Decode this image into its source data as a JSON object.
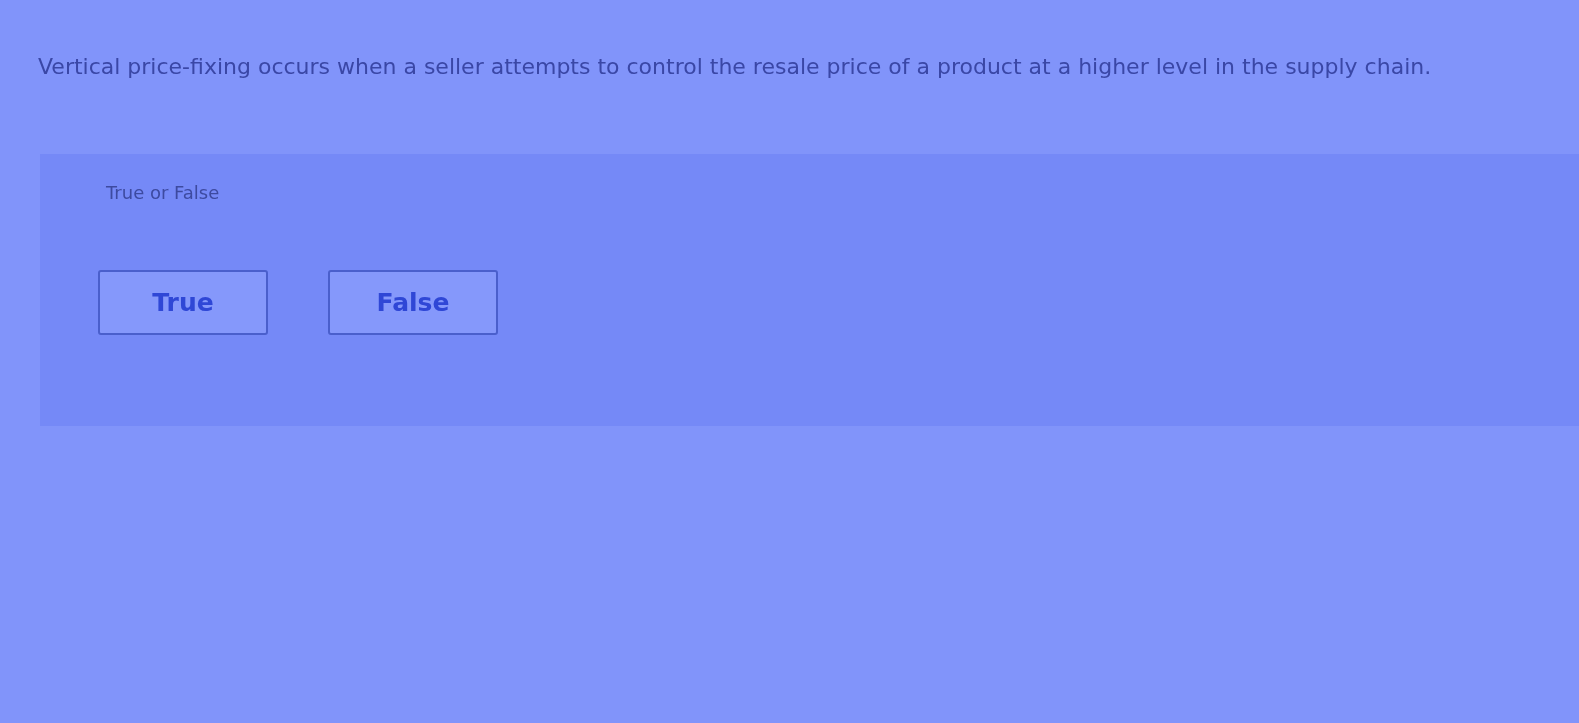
{
  "question": {
    "text": "Vertical price-fixing occurs when a seller attempts to control the resale price of a product at a higher level in the supply chain."
  },
  "answer_panel": {
    "label": "True or False",
    "options": [
      {
        "label": "True",
        "selected": false
      },
      {
        "label": "False",
        "selected": false
      }
    ]
  }
}
